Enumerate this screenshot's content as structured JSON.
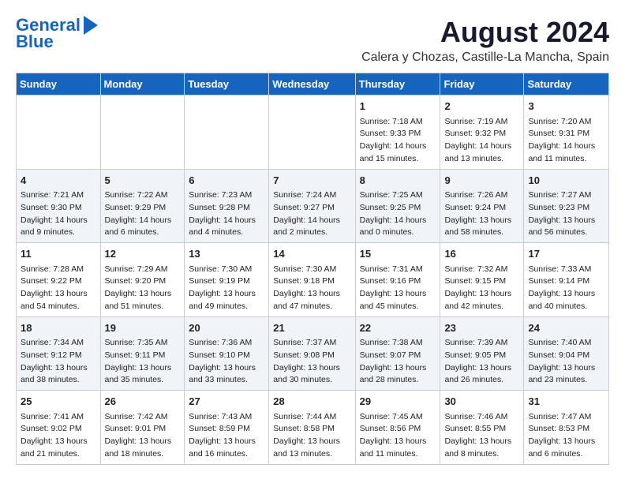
{
  "header": {
    "logo_line1": "General",
    "logo_line2": "Blue",
    "month_year": "August 2024",
    "location": "Calera y Chozas, Castille-La Mancha, Spain"
  },
  "weekdays": [
    "Sunday",
    "Monday",
    "Tuesday",
    "Wednesday",
    "Thursday",
    "Friday",
    "Saturday"
  ],
  "weeks": [
    [
      {
        "day": "",
        "info": ""
      },
      {
        "day": "",
        "info": ""
      },
      {
        "day": "",
        "info": ""
      },
      {
        "day": "",
        "info": ""
      },
      {
        "day": "1",
        "info": "Sunrise: 7:18 AM\nSunset: 9:33 PM\nDaylight: 14 hours\nand 15 minutes."
      },
      {
        "day": "2",
        "info": "Sunrise: 7:19 AM\nSunset: 9:32 PM\nDaylight: 14 hours\nand 13 minutes."
      },
      {
        "day": "3",
        "info": "Sunrise: 7:20 AM\nSunset: 9:31 PM\nDaylight: 14 hours\nand 11 minutes."
      }
    ],
    [
      {
        "day": "4",
        "info": "Sunrise: 7:21 AM\nSunset: 9:30 PM\nDaylight: 14 hours\nand 9 minutes."
      },
      {
        "day": "5",
        "info": "Sunrise: 7:22 AM\nSunset: 9:29 PM\nDaylight: 14 hours\nand 6 minutes."
      },
      {
        "day": "6",
        "info": "Sunrise: 7:23 AM\nSunset: 9:28 PM\nDaylight: 14 hours\nand 4 minutes."
      },
      {
        "day": "7",
        "info": "Sunrise: 7:24 AM\nSunset: 9:27 PM\nDaylight: 14 hours\nand 2 minutes."
      },
      {
        "day": "8",
        "info": "Sunrise: 7:25 AM\nSunset: 9:25 PM\nDaylight: 14 hours\nand 0 minutes."
      },
      {
        "day": "9",
        "info": "Sunrise: 7:26 AM\nSunset: 9:24 PM\nDaylight: 13 hours\nand 58 minutes."
      },
      {
        "day": "10",
        "info": "Sunrise: 7:27 AM\nSunset: 9:23 PM\nDaylight: 13 hours\nand 56 minutes."
      }
    ],
    [
      {
        "day": "11",
        "info": "Sunrise: 7:28 AM\nSunset: 9:22 PM\nDaylight: 13 hours\nand 54 minutes."
      },
      {
        "day": "12",
        "info": "Sunrise: 7:29 AM\nSunset: 9:20 PM\nDaylight: 13 hours\nand 51 minutes."
      },
      {
        "day": "13",
        "info": "Sunrise: 7:30 AM\nSunset: 9:19 PM\nDaylight: 13 hours\nand 49 minutes."
      },
      {
        "day": "14",
        "info": "Sunrise: 7:30 AM\nSunset: 9:18 PM\nDaylight: 13 hours\nand 47 minutes."
      },
      {
        "day": "15",
        "info": "Sunrise: 7:31 AM\nSunset: 9:16 PM\nDaylight: 13 hours\nand 45 minutes."
      },
      {
        "day": "16",
        "info": "Sunrise: 7:32 AM\nSunset: 9:15 PM\nDaylight: 13 hours\nand 42 minutes."
      },
      {
        "day": "17",
        "info": "Sunrise: 7:33 AM\nSunset: 9:14 PM\nDaylight: 13 hours\nand 40 minutes."
      }
    ],
    [
      {
        "day": "18",
        "info": "Sunrise: 7:34 AM\nSunset: 9:12 PM\nDaylight: 13 hours\nand 38 minutes."
      },
      {
        "day": "19",
        "info": "Sunrise: 7:35 AM\nSunset: 9:11 PM\nDaylight: 13 hours\nand 35 minutes."
      },
      {
        "day": "20",
        "info": "Sunrise: 7:36 AM\nSunset: 9:10 PM\nDaylight: 13 hours\nand 33 minutes."
      },
      {
        "day": "21",
        "info": "Sunrise: 7:37 AM\nSunset: 9:08 PM\nDaylight: 13 hours\nand 30 minutes."
      },
      {
        "day": "22",
        "info": "Sunrise: 7:38 AM\nSunset: 9:07 PM\nDaylight: 13 hours\nand 28 minutes."
      },
      {
        "day": "23",
        "info": "Sunrise: 7:39 AM\nSunset: 9:05 PM\nDaylight: 13 hours\nand 26 minutes."
      },
      {
        "day": "24",
        "info": "Sunrise: 7:40 AM\nSunset: 9:04 PM\nDaylight: 13 hours\nand 23 minutes."
      }
    ],
    [
      {
        "day": "25",
        "info": "Sunrise: 7:41 AM\nSunset: 9:02 PM\nDaylight: 13 hours\nand 21 minutes."
      },
      {
        "day": "26",
        "info": "Sunrise: 7:42 AM\nSunset: 9:01 PM\nDaylight: 13 hours\nand 18 minutes."
      },
      {
        "day": "27",
        "info": "Sunrise: 7:43 AM\nSunset: 8:59 PM\nDaylight: 13 hours\nand 16 minutes."
      },
      {
        "day": "28",
        "info": "Sunrise: 7:44 AM\nSunset: 8:58 PM\nDaylight: 13 hours\nand 13 minutes."
      },
      {
        "day": "29",
        "info": "Sunrise: 7:45 AM\nSunset: 8:56 PM\nDaylight: 13 hours\nand 11 minutes."
      },
      {
        "day": "30",
        "info": "Sunrise: 7:46 AM\nSunset: 8:55 PM\nDaylight: 13 hours\nand 8 minutes."
      },
      {
        "day": "31",
        "info": "Sunrise: 7:47 AM\nSunset: 8:53 PM\nDaylight: 13 hours\nand 6 minutes."
      }
    ]
  ]
}
